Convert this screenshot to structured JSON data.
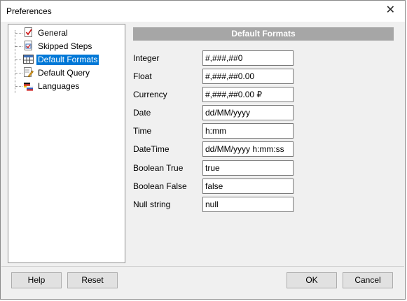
{
  "window": {
    "title": "Preferences",
    "close_glyph": "✕"
  },
  "tree": {
    "items": [
      {
        "label": "General",
        "icon": "check-doc-icon"
      },
      {
        "label": "Skipped Steps",
        "icon": "skipped-steps-icon"
      },
      {
        "label": "Default Formats",
        "icon": "table-icon",
        "selected": true
      },
      {
        "label": "Default Query",
        "icon": "edit-doc-icon"
      },
      {
        "label": "Languages",
        "icon": "flags-icon"
      }
    ]
  },
  "panel": {
    "header": "Default Formats",
    "fields": [
      {
        "label": "Integer",
        "value": "#,###,##0"
      },
      {
        "label": "Float",
        "value": "#,###,##0.00"
      },
      {
        "label": "Currency",
        "value": "#,###,##0.00 ₽"
      },
      {
        "label": "Date",
        "value": "dd/MM/yyyy"
      },
      {
        "label": "Time",
        "value": "h:mm"
      },
      {
        "label": "DateTime",
        "value": "dd/MM/yyyy h:mm:ss"
      },
      {
        "label": "Boolean True",
        "value": "true"
      },
      {
        "label": "Boolean False",
        "value": "false"
      },
      {
        "label": "Null string",
        "value": "null"
      }
    ]
  },
  "buttons": {
    "help": "Help",
    "reset": "Reset",
    "ok": "OK",
    "cancel": "Cancel"
  },
  "colors": {
    "selection": "#0078d7",
    "header_bg": "#a6a6a6",
    "dialog_bg": "#f0f0f0"
  }
}
